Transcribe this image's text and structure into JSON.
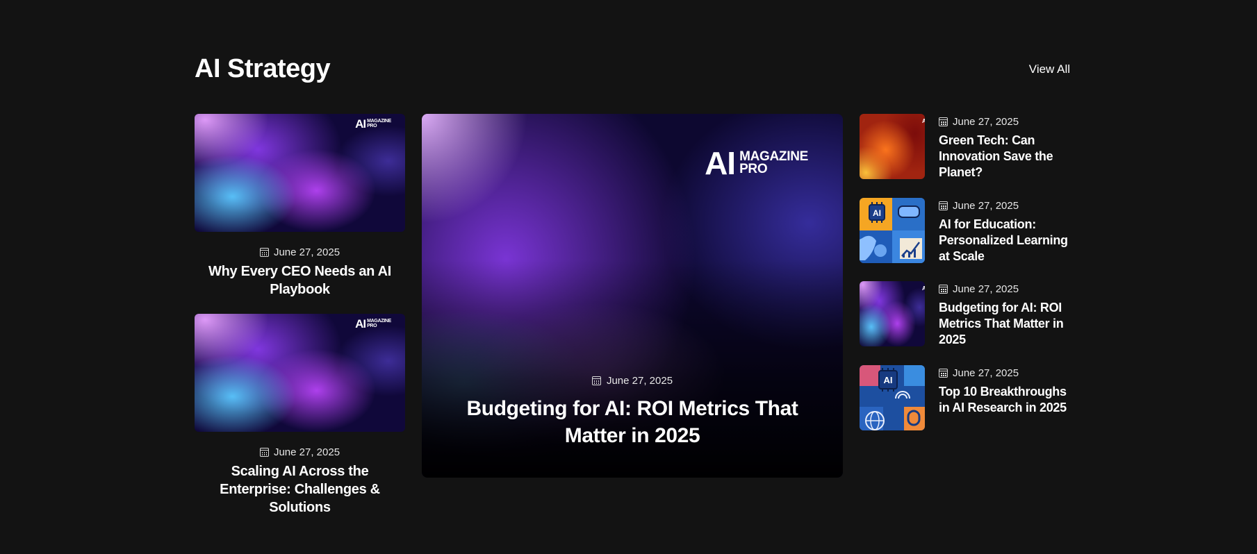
{
  "section": {
    "title": "AI Strategy",
    "view_all": "View All"
  },
  "brand": {
    "ai": "AI",
    "line1": "MAGAZINE",
    "line2": "PRO"
  },
  "left_cards": [
    {
      "date": "June 27, 2025",
      "title": "Why Every CEO Needs an AI Playbook"
    },
    {
      "date": "June 27, 2025",
      "title": "Scaling AI Across the Enterprise: Challenges & Solutions"
    }
  ],
  "featured": {
    "date": "June 27, 2025",
    "title": "Budgeting for AI: ROI Metrics That Matter in 2025"
  },
  "right_list": [
    {
      "date": "June 27, 2025",
      "title": "Green Tech: Can Innovation Save the Planet?"
    },
    {
      "date": "June 27, 2025",
      "title": "AI for Education: Personalized Learning at Scale"
    },
    {
      "date": "June 27, 2025",
      "title": "Budgeting for AI: ROI Metrics That Matter in 2025"
    },
    {
      "date": "June 27, 2025",
      "title": "Top 10 Breakthroughs in AI Research in 2025"
    }
  ],
  "icons": {
    "date": "calendar-icon"
  }
}
